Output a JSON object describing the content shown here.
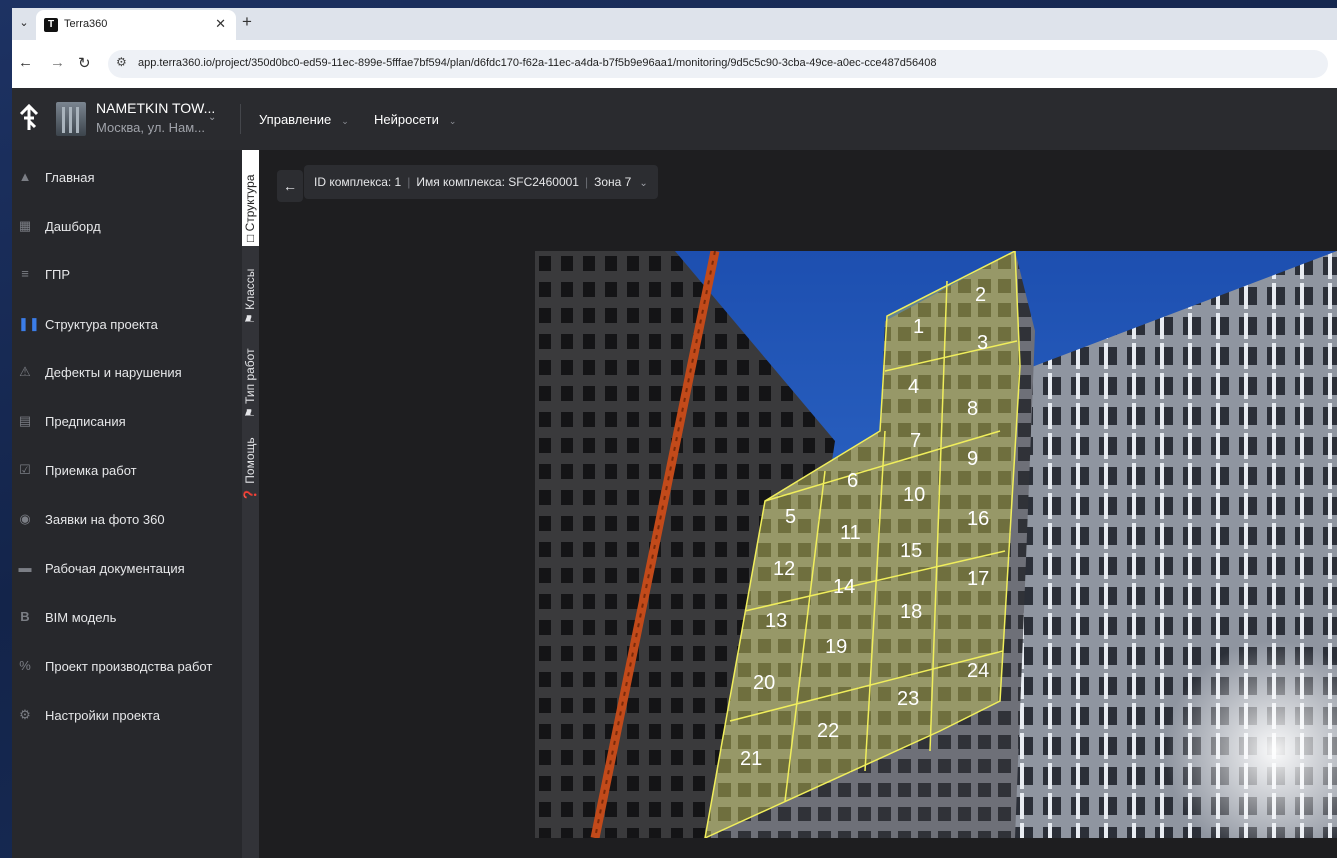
{
  "browser": {
    "tab_title": "Terra360",
    "url": "app.terra360.io/project/350d0bc0-ed59-11ec-899e-5fffae7bf594/plan/d6fdc170-f62a-11ec-a4da-b7f5b9e96aa1/monitoring/9d5c5c90-3cba-49ce-a0ec-cce487d56408"
  },
  "header": {
    "project_name": "NAMETKIN TOW...",
    "project_address": "Москва, ул. Нам...",
    "menus": [
      "Управление",
      "Нейросети"
    ]
  },
  "sidebar": {
    "items": [
      {
        "label": "Главная",
        "icon": "home-icon"
      },
      {
        "label": "Дашборд",
        "icon": "dashboard-icon"
      },
      {
        "label": "ГПР",
        "icon": "gantt-icon"
      },
      {
        "label": "Структура проекта",
        "icon": "structure-icon"
      },
      {
        "label": "Дефекты и нарушения",
        "icon": "warning-icon"
      },
      {
        "label": "Предписания",
        "icon": "clipboard-icon"
      },
      {
        "label": "Приемка работ",
        "icon": "check-clipboard-icon"
      },
      {
        "label": "Заявки на фото 360",
        "icon": "camera-icon"
      },
      {
        "label": "Рабочая документация",
        "icon": "folder-icon"
      },
      {
        "label": "BIM модель",
        "icon": "bim-icon"
      },
      {
        "label": "Проект производства работ",
        "icon": "percent-icon"
      },
      {
        "label": "Настройки проекта",
        "icon": "gear-icon"
      }
    ]
  },
  "rail": {
    "tabs": [
      {
        "label": "Структура",
        "icon": "folder-outline-icon"
      },
      {
        "label": "Классы",
        "icon": "flag-icon"
      },
      {
        "label": "Тип работ",
        "icon": "flag-icon"
      },
      {
        "label": "Помощь",
        "icon": "help-icon"
      }
    ]
  },
  "breadcrumb": {
    "complex_id": "ID комплекса: 1",
    "complex_name": "Имя комплекса: SFC2460001",
    "zone": "Зона 7"
  },
  "photo": {
    "zone_labels": [
      "1",
      "2",
      "3",
      "4",
      "5",
      "6",
      "7",
      "8",
      "9",
      "10",
      "11",
      "12",
      "13",
      "14",
      "15",
      "16",
      "17",
      "18",
      "19",
      "20",
      "21",
      "22",
      "23",
      "24"
    ]
  },
  "colors": {
    "accent_structure": "#3b7de8",
    "zone_overlay": "#e6e34a",
    "sidebar_bg": "#27282c",
    "header_bg": "#2a2b2f"
  }
}
